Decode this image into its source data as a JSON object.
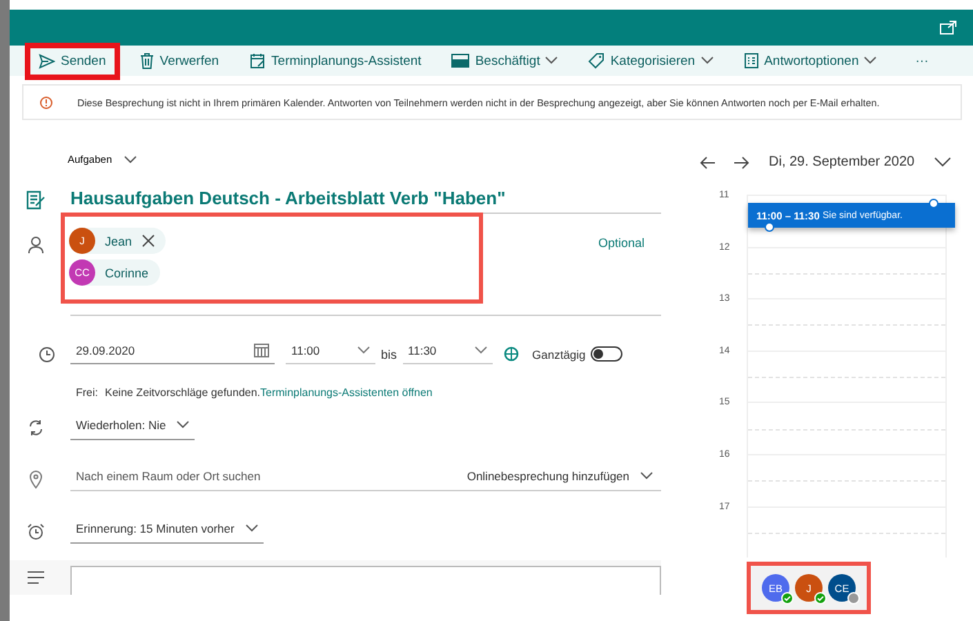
{
  "toolbar": {
    "items": [
      {
        "label": "Senden",
        "dropdown": false,
        "highlighted": true
      },
      {
        "label": "Verwerfen",
        "dropdown": false,
        "highlighted": false
      },
      {
        "label": "Terminplanungs-Assistent",
        "dropdown": false,
        "highlighted": false
      },
      {
        "label": "Beschäftigt",
        "dropdown": true,
        "highlighted": false
      },
      {
        "label": "Kategorisieren",
        "dropdown": true,
        "highlighted": false
      },
      {
        "label": "Antwortoptionen",
        "dropdown": true,
        "highlighted": false
      }
    ],
    "more": "···"
  },
  "notice": "Diese Besprechung ist nicht in Ihrem primären Kalender. Antworten von Teilnehmern werden nicht in der Besprechung angezeigt, aber Sie können Antworten noch per E-Mail erhalten.",
  "calendar_picker": "Aufgaben",
  "title": "Hausaufgaben Deutsch - Arbeitsblatt Verb \"Haben\"",
  "attendees": {
    "highlighted": true,
    "optional": "Optional",
    "people": [
      {
        "initials": "J",
        "name": "Jean",
        "color": "#ca5010",
        "removable": true
      },
      {
        "initials": "CC",
        "name": "Corinne",
        "color": "#c239b3",
        "removable": false
      }
    ]
  },
  "date": "29.09.2020",
  "start": "11:00",
  "until": "bis",
  "end": "11:30",
  "all_day": {
    "label": "Ganztägig",
    "on": false
  },
  "free": {
    "label": "Frei:",
    "text": "Keine Zeitvorschläge gefunden.",
    "link": "Terminplanungs-Assistenten öffnen"
  },
  "repeat": "Wiederholen: Nie",
  "location": {
    "placeholder": "Nach einem Raum oder Ort suchen",
    "online": "Onlinebesprechung hinzufügen"
  },
  "reminder": "Erinnerung: 15 Minuten vorher",
  "day_view": {
    "date": "Di, 29. September 2020",
    "hours": [
      "11",
      "12",
      "13",
      "14",
      "15",
      "16",
      "17"
    ],
    "event": {
      "time": "11:00 – 11:30",
      "text": "Sie sind verfügbar."
    }
  },
  "participants": {
    "highlighted": true,
    "people": [
      {
        "initials": "EB",
        "color": "#4f6bed",
        "accepted": true
      },
      {
        "initials": "J",
        "color": "#ca5010",
        "accepted": true
      },
      {
        "initials": "CE",
        "color": "#004e8c",
        "accepted": false
      }
    ]
  }
}
